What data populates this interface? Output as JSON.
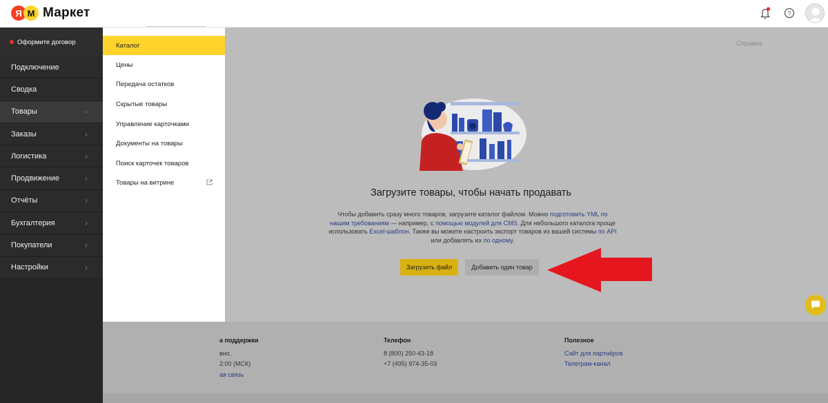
{
  "header": {
    "logo_ya": "Я",
    "logo_m": "М",
    "logo_text": "Маркет",
    "icons": [
      "bell-icon",
      "help-icon",
      "avatar"
    ]
  },
  "sidebar": {
    "contract": "Оформите договор",
    "items": [
      {
        "label": "Подключение",
        "chevron": false
      },
      {
        "label": "Сводка",
        "chevron": false
      },
      {
        "label": "Товары",
        "chevron": true
      },
      {
        "label": "Заказы",
        "chevron": true
      },
      {
        "label": "Логистика",
        "chevron": true
      },
      {
        "label": "Продвижение",
        "chevron": true
      },
      {
        "label": "Отчёты",
        "chevron": true
      },
      {
        "label": "Бухгалтерия",
        "chevron": true
      },
      {
        "label": "Покупатели",
        "chevron": true
      },
      {
        "label": "Настройки",
        "chevron": true
      }
    ]
  },
  "submenu": {
    "items": [
      {
        "label": "Каталог",
        "active": true
      },
      {
        "label": "Цены"
      },
      {
        "label": "Передача остатков"
      },
      {
        "label": "Скрытые товары"
      },
      {
        "label": "Управление карточками"
      },
      {
        "label": "Документы на товары"
      },
      {
        "label": "Поиск карточек товаров"
      },
      {
        "label": "Товары на витрине",
        "external": true
      }
    ]
  },
  "main": {
    "help_link": "Справка",
    "title": "Загрузите товары, чтобы начать продавать",
    "desc": {
      "t1": "Чтобы добавить сразу много товаров, загрузите каталог файлом. Можно ",
      "l1": "подготовить YML по нашим требованиям",
      "t2": " — например, с ",
      "l2": "помощью модулей для CMS",
      "t3": ". Для небольшого каталога проще использовать ",
      "l3": "Excel-шаблон",
      "t4": ". Также вы можете настроить экспорт товаров из вашей системы ",
      "l4": "по API",
      "t5": " или добавлять их ",
      "l5": "по одному",
      "t6": "."
    },
    "upload_button": "Загрузить файл",
    "add_button": "Добавить один товар"
  },
  "footer": {
    "support": {
      "title": "а поддержки",
      "line1": "вно,",
      "line2": "2:00 (МСК)",
      "link": "ая связь"
    },
    "phone": {
      "title": "Телефон",
      "line1": "8 (800) 250-43-18",
      "line2": "+7 (495) 974-35-03"
    },
    "useful": {
      "title": "Полезное",
      "link1": "Сайт для партнёров",
      "link2": "Телеграм-канал"
    }
  },
  "colors": {
    "accent_yellow": "#fed42b",
    "arrow_red": "#e5161e",
    "sidebar_dark": "#262626",
    "link_blue": "#2a3d86"
  }
}
